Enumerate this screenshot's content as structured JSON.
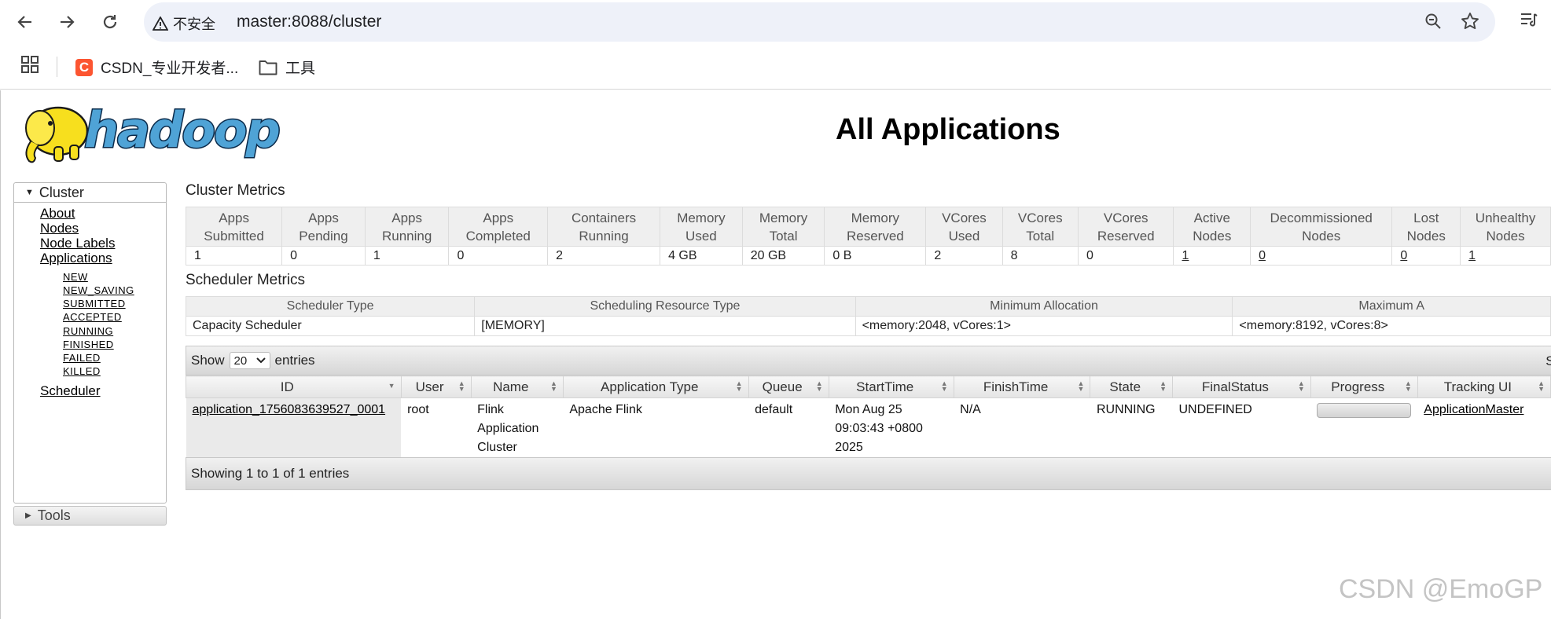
{
  "browser": {
    "security_label": "不安全",
    "url": "master:8088/cluster",
    "bookmarks": [
      {
        "label": "CSDN_专业开发者..."
      },
      {
        "label": "工具"
      }
    ]
  },
  "page": {
    "title": "All Applications",
    "logo_text": "hadoop"
  },
  "sidebar": {
    "cluster_label": "Cluster",
    "links": [
      "About",
      "Nodes",
      "Node Labels",
      "Applications"
    ],
    "app_states": [
      "NEW",
      "NEW_SAVING",
      "SUBMITTED",
      "ACCEPTED",
      "RUNNING",
      "FINISHED",
      "FAILED",
      "KILLED"
    ],
    "scheduler_link": "Scheduler",
    "tools_label": "Tools"
  },
  "cluster_metrics": {
    "title": "Cluster Metrics",
    "headers": [
      [
        "Apps",
        "Submitted"
      ],
      [
        "Apps",
        "Pending"
      ],
      [
        "Apps",
        "Running"
      ],
      [
        "Apps",
        "Completed"
      ],
      [
        "Containers",
        "Running"
      ],
      [
        "Memory",
        "Used"
      ],
      [
        "Memory",
        "Total"
      ],
      [
        "Memory",
        "Reserved"
      ],
      [
        "VCores",
        "Used"
      ],
      [
        "VCores",
        "Total"
      ],
      [
        "VCores",
        "Reserved"
      ],
      [
        "Active",
        "Nodes"
      ],
      [
        "Decommissioned",
        "Nodes"
      ],
      [
        "Lost",
        "Nodes"
      ],
      [
        "Unhealthy",
        "Nodes"
      ]
    ],
    "values": [
      "1",
      "0",
      "1",
      "0",
      "2",
      "4 GB",
      "20 GB",
      "0 B",
      "2",
      "8",
      "0",
      "1",
      "0",
      "0",
      "1"
    ]
  },
  "scheduler_metrics": {
    "title": "Scheduler Metrics",
    "headers": [
      "Scheduler Type",
      "Scheduling Resource Type",
      "Minimum Allocation",
      "Maximum A"
    ],
    "values": [
      "Capacity Scheduler",
      "[MEMORY]",
      "<memory:2048, vCores:1>",
      "<memory:8192, vCores:8>"
    ]
  },
  "apps_table": {
    "show_label": "Show",
    "page_size": "20",
    "entries_label": "entries",
    "search_label": "Se",
    "headers": [
      "ID",
      "User",
      "Name",
      "Application Type",
      "Queue",
      "StartTime",
      "FinishTime",
      "State",
      "FinalStatus",
      "Progress",
      "Tracking UI"
    ],
    "rows": [
      {
        "id": "application_1756083639527_0001",
        "user": "root",
        "name": "Flink Application Cluster",
        "type": "Apache Flink",
        "queue": "default",
        "start": "Mon Aug 25 09:03:43 +0800 2025",
        "finish": "N/A",
        "state": "RUNNING",
        "final_status": "UNDEFINED",
        "progress": 0,
        "tracking": "ApplicationMaster"
      }
    ],
    "info": "Showing 1 to 1 of 1 entries"
  },
  "watermark": "CSDN @EmoGP",
  "colors": {
    "omnibox": "#eef1f9",
    "csdn_brand": "#fc5531",
    "hadoop_yellow": "#f7df1e",
    "hadoop_blue": "#4fa3d6"
  }
}
